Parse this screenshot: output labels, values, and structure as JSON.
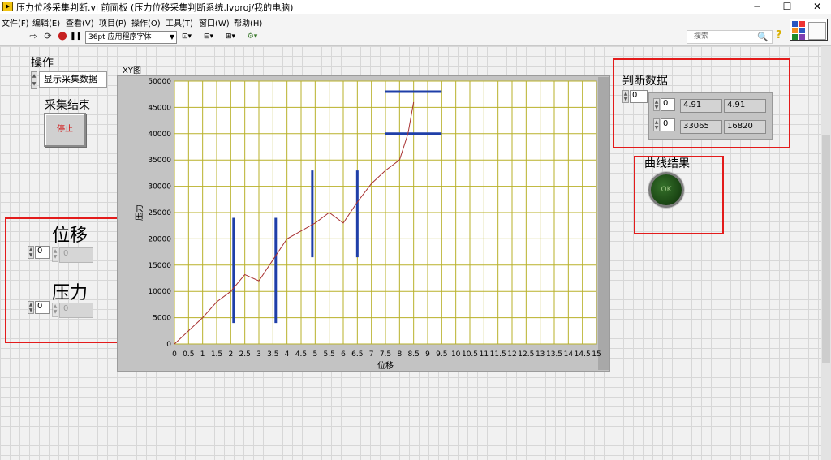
{
  "window": {
    "title": "压力位移采集判断.vi 前面板 (压力位移采集判断系统.lvproj/我的电脑)",
    "minimize": "─",
    "maximize": "☐",
    "close": "✕"
  },
  "menu": [
    "文件(F)",
    "编辑(E)",
    "查看(V)",
    "项目(P)",
    "操作(O)",
    "工具(T)",
    "窗口(W)",
    "帮助(H)"
  ],
  "toolbar": {
    "run_icon": "⇨",
    "run_continuous_icon": "⟳",
    "abort_icon": "⬤",
    "pause_icon": "❚❚",
    "font_select": "36pt 应用程序字体",
    "align_icon": "⊡▾",
    "distribute_icon": "⊟▾",
    "resize_icon": "⊞▾",
    "reorder_icon": "⚙▾",
    "search_placeholder": "搜索",
    "search_icon": "🔍",
    "help_icon": "?"
  },
  "controls": {
    "operation_label": "操作",
    "operation_value": "显示采集数据",
    "collection_end_label": "采集结束",
    "stop_button_label": "停止",
    "displacement_label": "位移",
    "displacement_index": "0",
    "displacement_value": "0",
    "pressure_label": "压力",
    "pressure_index": "0",
    "pressure_value": "0",
    "judge_label": "判断数据",
    "judge_index_outer": "0",
    "judge_row_index_1": "0",
    "judge_row_index_2": "0",
    "judge_values": [
      [
        "4.91",
        "4.91"
      ],
      [
        "33065",
        "16820"
      ]
    ],
    "curve_result_label": "曲线结果",
    "curve_result_value": "OK"
  },
  "chart_data": {
    "type": "line",
    "title": "XY图",
    "xlabel": "位移",
    "ylabel": "压力",
    "xlim": [
      0,
      15
    ],
    "ylim": [
      0,
      50000
    ],
    "xticks": [
      "0",
      "0.5",
      "1",
      "1.5",
      "2",
      "2.5",
      "3",
      "3.5",
      "4",
      "4.5",
      "5",
      "5.5",
      "6",
      "6.5",
      "7",
      "7.5",
      "8",
      "8.5",
      "9",
      "9.5",
      "10",
      "10.5",
      "11",
      "11.5",
      "12",
      "12.5",
      "13",
      "13.5",
      "14",
      "14.5",
      "15"
    ],
    "yticks": [
      "0",
      "5000",
      "10000",
      "15000",
      "20000",
      "25000",
      "30000",
      "35000",
      "40000",
      "45000",
      "50000"
    ],
    "grid": true,
    "colors": {
      "plot_background": "#ffffff",
      "grid": "#b9b12a",
      "curve": "#a83232",
      "limits": "#1f3fa8",
      "axis_text": "#000000"
    },
    "series": [
      {
        "style": "curve",
        "points": [
          [
            0,
            0
          ],
          [
            0.5,
            2500
          ],
          [
            1,
            5000
          ],
          [
            1.5,
            8000
          ],
          [
            2,
            10000
          ],
          [
            2.5,
            13200
          ],
          [
            3,
            12000
          ],
          [
            3.5,
            16000
          ],
          [
            4,
            20000
          ],
          [
            4.5,
            21500
          ],
          [
            5,
            23000
          ],
          [
            5.5,
            25000
          ],
          [
            6,
            23000
          ],
          [
            6.5,
            27000
          ],
          [
            7,
            30500
          ],
          [
            7.5,
            33000
          ],
          [
            8,
            35000
          ],
          [
            8.3,
            40000
          ],
          [
            8.5,
            46000
          ]
        ]
      }
    ],
    "limit_lines": [
      {
        "orientation": "vertical",
        "x": 2.1,
        "y1": 4000,
        "y2": 24000
      },
      {
        "orientation": "vertical",
        "x": 3.6,
        "y1": 4000,
        "y2": 24000
      },
      {
        "orientation": "vertical",
        "x": 4.9,
        "y1": 16500,
        "y2": 33000
      },
      {
        "orientation": "vertical",
        "x": 6.5,
        "y1": 16500,
        "y2": 33000
      },
      {
        "orientation": "horizontal",
        "y": 48000,
        "x1": 7.5,
        "x2": 9.5
      },
      {
        "orientation": "horizontal",
        "y": 40000,
        "x1": 7.5,
        "x2": 9.5
      }
    ]
  }
}
